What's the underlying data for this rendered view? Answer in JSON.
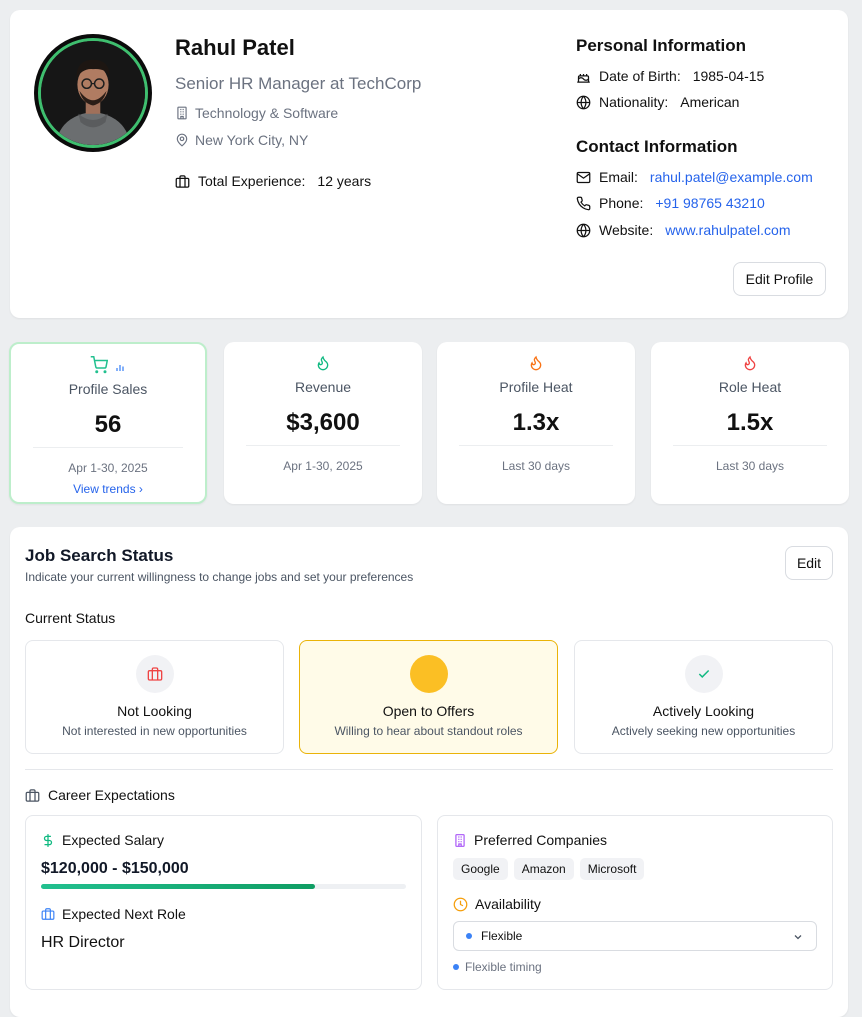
{
  "profile": {
    "name": "Rahul Patel",
    "title": "Senior HR Manager at TechCorp",
    "industry": "Technology & Software",
    "location": "New York City, NY",
    "experience_label": "Total Experience:",
    "experience_value": "12 years",
    "edit_label": "Edit Profile"
  },
  "personal": {
    "heading": "Personal Information",
    "dob_label": "Date of Birth:",
    "dob_value": "1985-04-15",
    "nationality_label": "Nationality:",
    "nationality_value": "American"
  },
  "contact": {
    "heading": "Contact Information",
    "email_label": "Email:",
    "email_value": "rahul.patel@example.com",
    "phone_label": "Phone:",
    "phone_value": "+91 98765 43210",
    "website_label": "Website:",
    "website_value": "www.rahulpatel.com"
  },
  "stats": [
    {
      "label": "Profile Sales",
      "value": "56",
      "period": "Apr 1-30, 2025",
      "link": "View trends ›",
      "icon": "cart-icon"
    },
    {
      "label": "Revenue",
      "value": "$3,600",
      "period": "Apr 1-30, 2025",
      "icon": "flame-icon"
    },
    {
      "label": "Profile Heat",
      "value": "1.3x",
      "period": "Last 30 days",
      "icon": "flame-icon"
    },
    {
      "label": "Role Heat",
      "value": "1.5x",
      "period": "Last 30 days",
      "icon": "flame-icon"
    }
  ],
  "job": {
    "title": "Job Search Status",
    "subtitle": "Indicate your current willingness to change jobs and set your preferences",
    "edit_label": "Edit",
    "current_status_label": "Current Status",
    "options": [
      {
        "label": "Not Looking",
        "desc": "Not interested in new opportunities",
        "icon": "briefcase-icon"
      },
      {
        "label": "Open to Offers",
        "desc": "Willing to hear about standout roles",
        "icon": "circle-icon",
        "selected": true
      },
      {
        "label": "Actively Looking",
        "desc": "Actively seeking new opportunities",
        "icon": "check-icon"
      }
    ],
    "career_label": "Career Expectations",
    "salary_label": "Expected Salary",
    "salary_value": "$120,000 - $150,000",
    "salary_bar_fraction": 0.75,
    "next_role_label": "Expected Next Role",
    "next_role_value": "HR Director",
    "companies_label": "Preferred Companies",
    "companies": [
      "Google",
      "Amazon",
      "Microsoft"
    ],
    "availability_label": "Availability",
    "availability_value": "Flexible",
    "availability_hint": "Flexible timing"
  },
  "colors": {
    "accent_blue": "#2563eb",
    "green": "#22c08f",
    "orange": "#f97316",
    "red": "#ef4444",
    "yellow": "#fbbf24"
  }
}
